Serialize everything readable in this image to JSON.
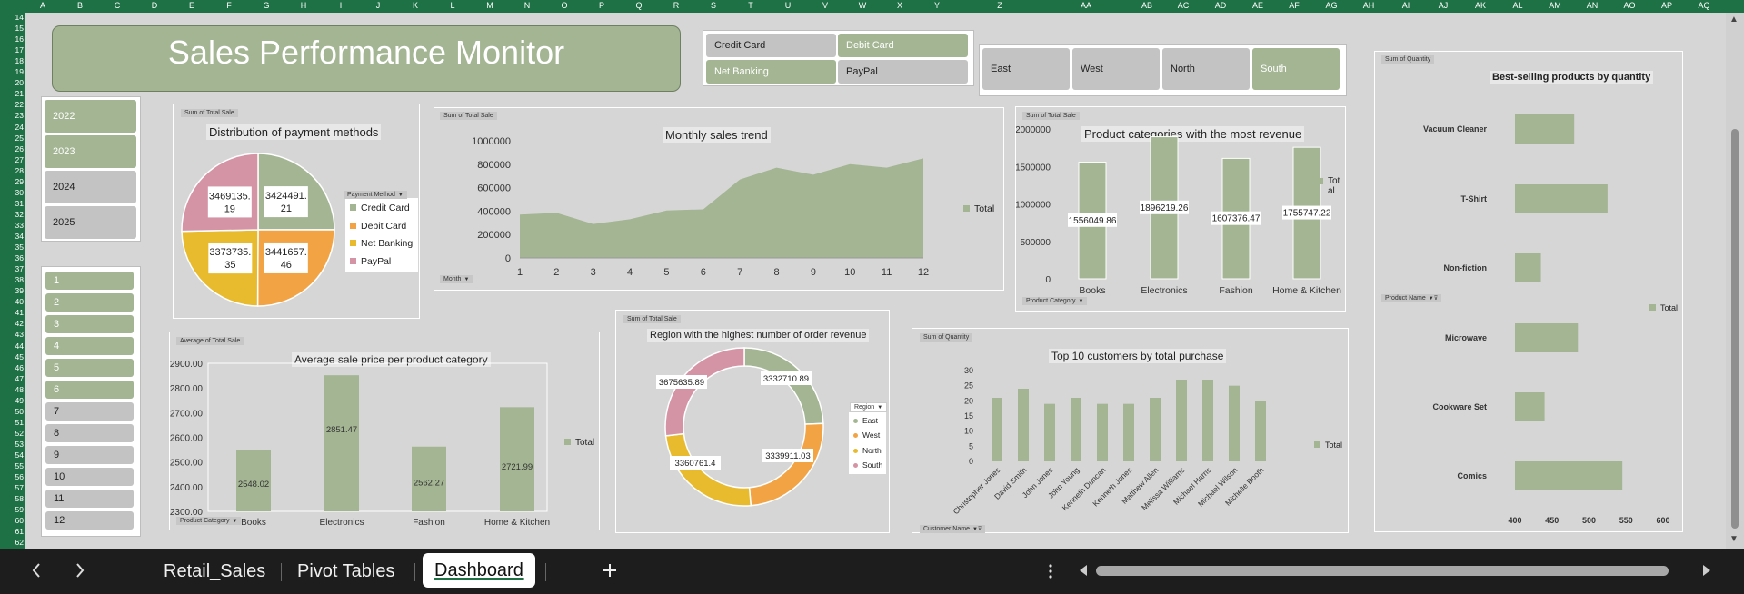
{
  "column_headers": [
    "A",
    "B",
    "C",
    "D",
    "E",
    "F",
    "G",
    "H",
    "I",
    "J",
    "K",
    "L",
    "M",
    "N",
    "O",
    "P",
    "Q",
    "R",
    "S",
    "T",
    "U",
    "V",
    "W",
    "X",
    "Y",
    "Z",
    "AA",
    "AB",
    "AC",
    "AD",
    "AE",
    "AF",
    "AG",
    "AH",
    "AI",
    "AJ",
    "AK",
    "AL",
    "AM",
    "AN",
    "AO",
    "AP",
    "AQ"
  ],
  "row_headers": [
    "14",
    "15",
    "16",
    "17",
    "18",
    "19",
    "20",
    "21",
    "22",
    "23",
    "24",
    "25",
    "26",
    "27",
    "28",
    "29",
    "30",
    "31",
    "32",
    "33",
    "34",
    "35",
    "36",
    "37",
    "38",
    "39",
    "40",
    "41",
    "42",
    "43",
    "44",
    "45",
    "46",
    "47",
    "48",
    "49",
    "50",
    "51",
    "52",
    "53",
    "54",
    "55",
    "56",
    "57",
    "58",
    "59",
    "60",
    "61",
    "62"
  ],
  "dashboard": {
    "title": "Sales Performance Monitor"
  },
  "colors": {
    "green": "#a3b592",
    "orange": "#f2a444",
    "yellow": "#e8bb2f",
    "pink": "#d594a5",
    "header_green": "#1e7145"
  },
  "slicers": {
    "year": [
      {
        "label": "2022",
        "selected": true
      },
      {
        "label": "2023",
        "selected": true
      },
      {
        "label": "2024",
        "selected": false
      },
      {
        "label": "2025",
        "selected": false
      }
    ],
    "month": [
      {
        "label": "1",
        "selected": true
      },
      {
        "label": "2",
        "selected": true
      },
      {
        "label": "3",
        "selected": true
      },
      {
        "label": "4",
        "selected": true
      },
      {
        "label": "5",
        "selected": true
      },
      {
        "label": "6",
        "selected": true
      },
      {
        "label": "7",
        "selected": false
      },
      {
        "label": "8",
        "selected": false
      },
      {
        "label": "9",
        "selected": false
      },
      {
        "label": "10",
        "selected": false
      },
      {
        "label": "11",
        "selected": false
      },
      {
        "label": "12",
        "selected": false
      }
    ],
    "payment": [
      {
        "label": "Credit Card",
        "selected": false
      },
      {
        "label": "Debit Card",
        "selected": true
      },
      {
        "label": "Net Banking",
        "selected": true
      },
      {
        "label": "PayPal",
        "selected": false
      }
    ],
    "region": [
      {
        "label": "East",
        "selected": false
      },
      {
        "label": "West",
        "selected": false
      },
      {
        "label": "North",
        "selected": false
      },
      {
        "label": "South",
        "selected": true
      }
    ]
  },
  "pie": {
    "tag": "Sum of Total Sale",
    "title": "Distribution of payment methods",
    "legend_tag": "Payment Method",
    "labels": [
      "3424491.\n21",
      "3441657.\n46",
      "3373735.\n35",
      "3469135.\n19"
    ]
  },
  "line": {
    "tag": "Sum of Total Sale",
    "title": "Monthly sales trend",
    "filter_tag": "Month",
    "legend": "Total"
  },
  "cat_rev": {
    "tag": "Sum of Total Sale",
    "title": "Product categories with the most revenue",
    "filter_tag": "Product Category",
    "legend": "Tot\nal"
  },
  "qty": {
    "tag": "Sum of Quantity",
    "title": "Best-selling products by quantity",
    "filter_tag": "Product Name",
    "legend": "Total"
  },
  "avg": {
    "tag": "Average of Total Sale",
    "title": "Average sale price per product category",
    "filter_tag": "Product Category",
    "legend": "Total"
  },
  "donut": {
    "tag": "Sum of Total Sale",
    "title": "Region with the highest number of order revenue",
    "legend_tag": "Region"
  },
  "cust": {
    "tag": "Sum of Quantity",
    "title": "Top 10 customers by total purchase",
    "filter_tag": "Customer Name",
    "legend": "Total"
  },
  "chart_data": [
    {
      "type": "pie",
      "title": "Distribution of payment methods",
      "categories": [
        "Credit Card",
        "Debit Card",
        "Net Banking",
        "PayPal"
      ],
      "values": [
        3424491.21,
        3441657.46,
        3373735.35,
        3469135.19
      ],
      "colors": [
        "#a3b592",
        "#f2a444",
        "#e8bb2f",
        "#d594a5"
      ],
      "legend": "right"
    },
    {
      "type": "area",
      "title": "Monthly sales trend",
      "x": [
        1,
        2,
        3,
        4,
        5,
        6,
        7,
        8,
        9,
        10,
        11,
        12
      ],
      "values": [
        370000,
        385000,
        290000,
        330000,
        405000,
        415000,
        670000,
        770000,
        710000,
        800000,
        770000,
        850000
      ],
      "ylim": [
        0,
        1000000
      ],
      "yticks": [
        "1000000",
        "800000",
        "600000",
        "400000",
        "200000",
        "0"
      ],
      "series_name": "Total"
    },
    {
      "type": "bar",
      "title": "Product categories with the most revenue",
      "categories": [
        "Books",
        "Electronics",
        "Fashion",
        "Home & Kitchen"
      ],
      "values": [
        1556049.86,
        1896219.26,
        1607376.47,
        1755747.22
      ],
      "labels": [
        "1556049.86",
        "1896219.26",
        "1607376.47",
        "1755747.22"
      ],
      "ylim": [
        0,
        2000000
      ],
      "yticks": [
        "2000000",
        "1500000",
        "1000000",
        "500000",
        "0"
      ]
    },
    {
      "type": "bar",
      "title": "Best-selling products by quantity",
      "orientation": "horizontal",
      "categories": [
        "Vacuum Cleaner",
        "T-Shirt",
        "Non-fiction",
        "Microwave",
        "Cookware Set",
        "Comics"
      ],
      "values": [
        480,
        525,
        435,
        485,
        440,
        545
      ],
      "xlim": [
        400,
        600
      ],
      "xticks": [
        "400",
        "450",
        "500",
        "550",
        "600"
      ],
      "series_name": "Total"
    },
    {
      "type": "bar",
      "title": "Average sale price per product category",
      "categories": [
        "Books",
        "Electronics",
        "Fashion",
        "Home & Kitchen"
      ],
      "values": [
        2548.02,
        2851.47,
        2562.27,
        2721.99
      ],
      "labels": [
        "2548.02",
        "2851.47",
        "2562.27",
        "2721.99"
      ],
      "ylim": [
        2300,
        2900
      ],
      "yticks": [
        "2900.00",
        "2800.00",
        "2700.00",
        "2600.00",
        "2500.00",
        "2400.00",
        "2300.00"
      ],
      "series_name": "Total"
    },
    {
      "type": "pie",
      "title": "Region with the highest number of order revenue",
      "donut": true,
      "categories": [
        "East",
        "West",
        "North",
        "South"
      ],
      "values": [
        3332710.89,
        3339911.03,
        3360761.4,
        3675635.89
      ],
      "labels": [
        "3332710.89",
        "3339911.03",
        "3360761.4",
        "3675635.89"
      ],
      "colors": [
        "#a3b592",
        "#f2a444",
        "#e8bb2f",
        "#d594a5"
      ]
    },
    {
      "type": "bar",
      "title": "Top 10 customers by total purchase",
      "categories": [
        "Christopher Jones",
        "David Smith",
        "John Jones",
        "John Young",
        "Kenneth Duncan",
        "Kenneth Jones",
        "Matthew Allen",
        "Melissa Williams",
        "Michael Harris",
        "Michael Wilson",
        "Michelle Booth"
      ],
      "values": [
        21,
        24,
        19,
        21,
        19,
        19,
        21,
        27,
        27,
        25,
        20
      ],
      "ylim": [
        0,
        30
      ],
      "yticks": [
        "30",
        "25",
        "20",
        "15",
        "10",
        "5",
        "0"
      ],
      "series_name": "Total"
    }
  ],
  "sheet_tabs": [
    "Retail_Sales",
    "Pivot Tables",
    "Dashboard"
  ],
  "active_tab": "Dashboard",
  "icons": {
    "prev": "chevron-left-icon",
    "next": "chevron-right-icon",
    "add": "plus-icon",
    "more": "more-vertical-icon"
  }
}
